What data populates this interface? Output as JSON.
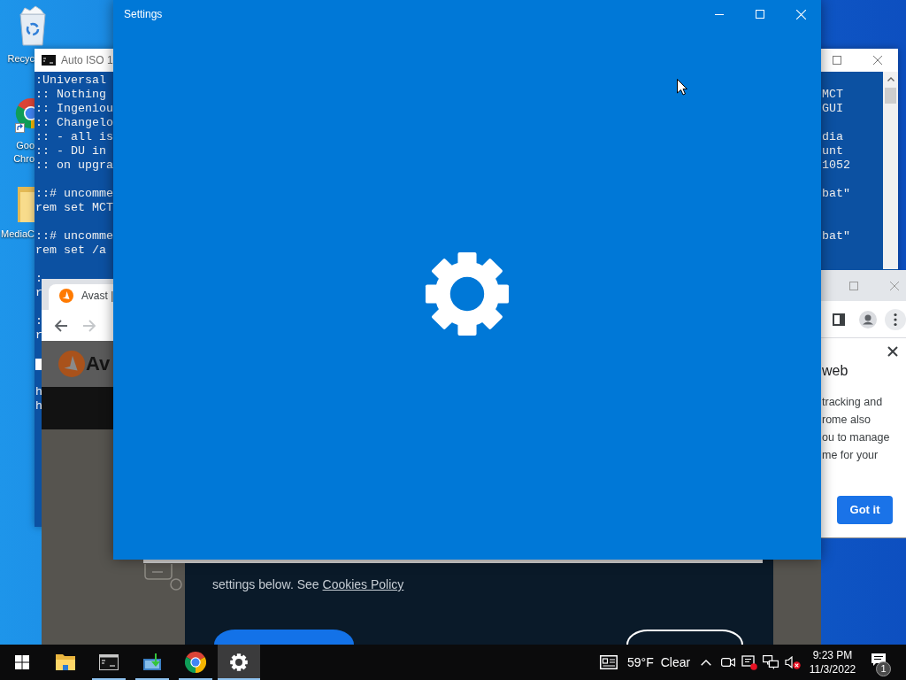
{
  "desktop_icons": [
    {
      "kind": "recycle-bin",
      "lines": [
        "Recyc"
      ]
    },
    {
      "kind": "browser",
      "lines": [
        "Goo",
        "Chro"
      ]
    },
    {
      "kind": "folder",
      "lines": [
        "MediaC"
      ]
    }
  ],
  "console_window": {
    "title": "Auto ISO 1",
    "rows": [
      {
        "kind": "text",
        "start": ":Universal"
      },
      {
        "kind": "text",
        "start": ":: Nothing",
        "end": "MCT"
      },
      {
        "kind": "text",
        "start": ":: Ingeniou",
        "end": "GUI"
      },
      {
        "kind": "text",
        "start": ":: Changelo"
      },
      {
        "kind": "text",
        "start": ":: - all is",
        "end": "dia"
      },
      {
        "kind": "text",
        "start": ":: - DU in",
        "end": "unt"
      },
      {
        "kind": "text",
        "start": ":: on upgra",
        "end": "1052"
      },
      {
        "kind": "blank"
      },
      {
        "kind": "text",
        "start": "::# uncomme",
        "end": "bat\""
      },
      {
        "kind": "text",
        "start": "rem set MCT"
      },
      {
        "kind": "blank"
      },
      {
        "kind": "text",
        "start": "::# uncomme",
        "end": "bat\""
      },
      {
        "kind": "text",
        "start": "rem set /a"
      },
      {
        "kind": "blank"
      },
      {
        "kind": "text",
        "start": ":"
      },
      {
        "kind": "text",
        "start": "r"
      },
      {
        "kind": "blank"
      },
      {
        "kind": "text",
        "start": ":"
      },
      {
        "kind": "text",
        "start": "r"
      },
      {
        "kind": "blank"
      },
      {
        "kind": "cursor"
      },
      {
        "kind": "blank"
      },
      {
        "kind": "text",
        "start": "h"
      },
      {
        "kind": "text",
        "start": "h"
      }
    ]
  },
  "browser_window_left": {
    "tab": {
      "title": "Avast |"
    },
    "logo_text": "Av",
    "cookie_banner": {
      "text": "settings below. See ",
      "link": "Cookies Policy",
      "buttons": [
        {
          "kind": "filled"
        },
        {
          "kind": "outlined"
        }
      ]
    }
  },
  "browser_window_right": {
    "popup": {
      "heading": "web",
      "lines": [
        "tracking and",
        "rome also",
        "ou to manage",
        "me for your"
      ],
      "button": "Got it"
    }
  },
  "settings_window": {
    "title": "Settings"
  },
  "taskbar": {
    "apps": [
      {
        "kind": "file-explorer",
        "running": false,
        "selected": false
      },
      {
        "kind": "console",
        "running": true,
        "selected": false
      },
      {
        "kind": "installer",
        "running": true,
        "selected": false
      },
      {
        "kind": "browser",
        "running": true,
        "selected": false
      },
      {
        "kind": "settings",
        "running": true,
        "selected": true
      }
    ],
    "weather": {
      "temperature": "59°F",
      "condition": "Clear"
    },
    "clock": {
      "time": "9:23 PM",
      "date": "11/3/2022"
    },
    "notifications": {
      "count": "1"
    }
  }
}
